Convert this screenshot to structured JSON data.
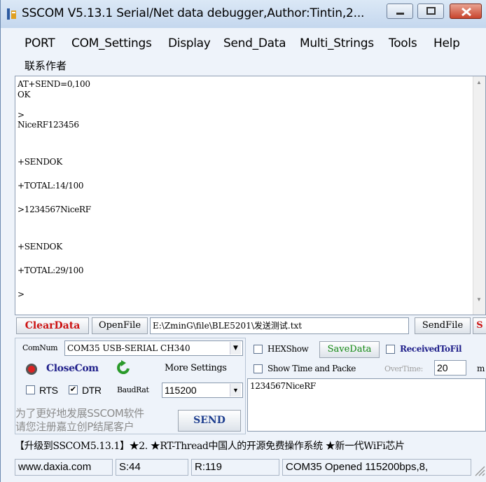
{
  "window": {
    "title": "SSCOM V5.13.1 Serial/Net data debugger,Author:Tintin,2..."
  },
  "menu": {
    "items": [
      "PORT",
      "COM_Settings",
      "Display",
      "Send_Data",
      "Multi_Strings",
      "Tools",
      "Help"
    ],
    "contact": "联系作者"
  },
  "output": {
    "lines": [
      "AT+SEND=0,100",
      "OK",
      ">",
      "NiceRF123456",
      "+SENDOK",
      "+TOTAL:14/100",
      ">1234567NiceRF",
      "+SENDOK",
      "+TOTAL:29/100",
      ">"
    ]
  },
  "toolbar": {
    "clear": "ClearData",
    "open": "OpenFile",
    "path": "E:\\ZminG\\file\\BLE5201\\发送测试.txt",
    "sendfile": "SendFile",
    "next": "S"
  },
  "port": {
    "comnum_label": "ComNum",
    "comnum_value": "COM35 USB-SERIAL CH340",
    "close": "CloseCom",
    "more": "More Settings",
    "rts": "RTS",
    "dtr": "DTR",
    "baud_label": "BaudRat",
    "baud_value": "115200"
  },
  "options": {
    "hexshow": "HEXShow",
    "savedata": "SaveData",
    "received": "ReceivedToFil",
    "showtime": "Show Time and Packe",
    "overtime": "OverTime:",
    "overtime_value": "20",
    "ms": "m"
  },
  "send": {
    "text": "1234567NiceRF",
    "button": "SEND"
  },
  "promo": {
    "line1": "为了更好地发展SSCOM软件",
    "line2": "请您注册嘉立创P结尾客户"
  },
  "ticker": "【升级到SSCOM5.13.1】★2. ★RT-Thread中国人的开源免费操作系统 ★新一代WiFi芯片",
  "status": {
    "site": "www.daxia.com",
    "sent": "S:44",
    "received": "R:119",
    "port": "COM35 Opened  115200bps,8,"
  },
  "colors": {
    "clear": "#cc1111",
    "savedata": "#118811",
    "received": "#1f1f8a",
    "send": "#1f3f8f"
  }
}
